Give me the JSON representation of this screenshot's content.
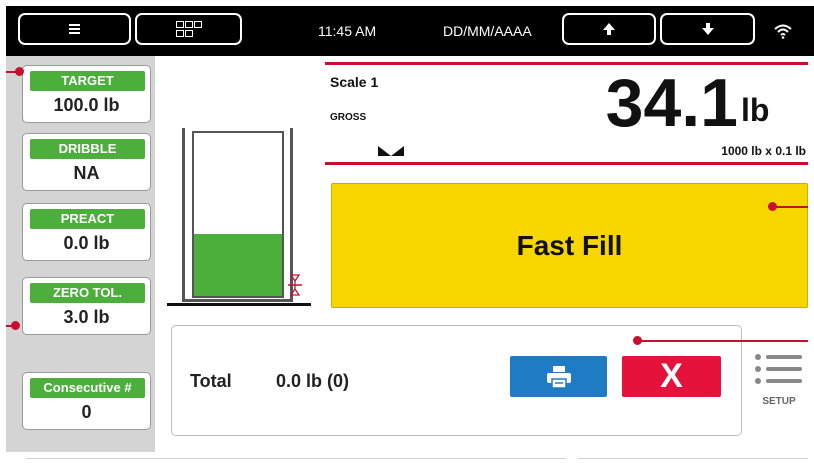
{
  "status_bar": {
    "time": "11:45 AM",
    "date_format": "DD/MM/AAAA",
    "icons": [
      "menu-icon",
      "grid-icon",
      "arrow-up-icon",
      "arrow-down-icon",
      "wifi-icon"
    ]
  },
  "setpoints": [
    {
      "label": "TARGET",
      "value": "100.0 lb"
    },
    {
      "label": "DRIBBLE",
      "value": "NA"
    },
    {
      "label": "PREACT",
      "value": "0.0 lb"
    },
    {
      "label": "ZERO TOL.",
      "value": "3.0 lb"
    },
    {
      "label": "Consecutive #",
      "value": "0"
    }
  ],
  "tank": {
    "fill_fraction": 0.38,
    "fill_color": "#4caf3b"
  },
  "scale": {
    "name": "Scale 1",
    "mode": "GROSS",
    "weight": "34.1",
    "unit": "lb",
    "capacity": "1000 lb x 0.1 lb"
  },
  "status": {
    "text": "Fast Fill",
    "color": "#f7d600"
  },
  "totals": {
    "label": "Total",
    "value": "0.0 lb (0)"
  },
  "actions": {
    "cancel_label": "X",
    "print_color": "#1e7bc4",
    "cancel_color": "#e5123b"
  },
  "setup": {
    "label": "SETUP"
  },
  "colors": {
    "accent_red": "#c8102e",
    "label_green": "#4caf3b",
    "sidebar_gray": "#d4d4d4"
  }
}
